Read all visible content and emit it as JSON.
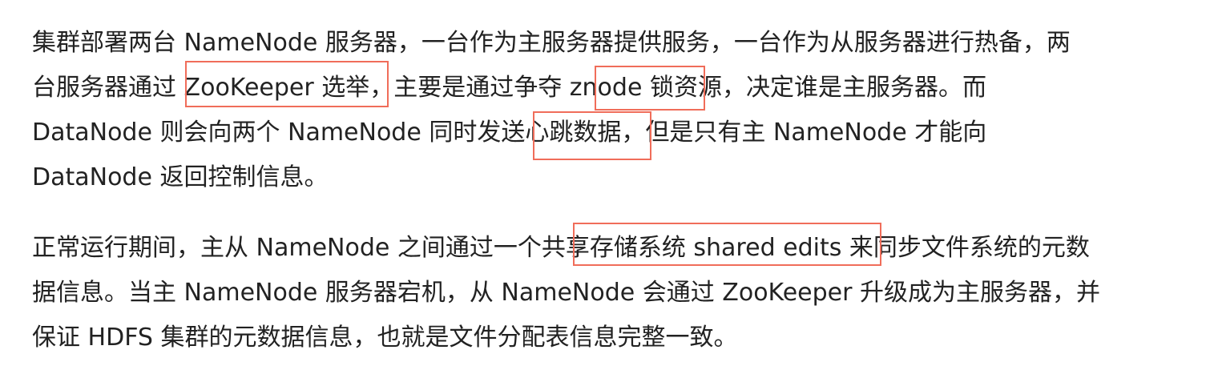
{
  "paragraphs": [
    {
      "lines": [
        "集群部署两台 NameNode 服务器，一台作为主服务器提供服务，一台作为从服务器进行热备，两",
        "台服务器通过 ZooKeeper 选举，主要是通过争夺 znode 锁资源，决定谁是主服务器。而",
        "DataNode 则会向两个 NameNode 同时发送心跳数据，但是只有主 NameNode 才能向",
        "DataNode 返回控制信息。"
      ]
    },
    {
      "lines": [
        "正常运行期间，主从 NameNode 之间通过一个共享存储系统 shared edits 来同步文件系统的元数",
        "据信息。当主 NameNode 服务器宕机，从 NameNode 会通过 ZooKeeper 升级成为主服务器，并",
        "保证 HDFS 集群的元数据信息，也就是文件分配表信息完整一致。"
      ]
    }
  ],
  "highlights": [
    "ZooKeeper 选举",
    "znode 锁",
    "心跳数据",
    "共享存储系统 shared edits"
  ],
  "colors": {
    "text": "#222222",
    "highlight_border": "#f06d5a",
    "background": "#ffffff"
  }
}
